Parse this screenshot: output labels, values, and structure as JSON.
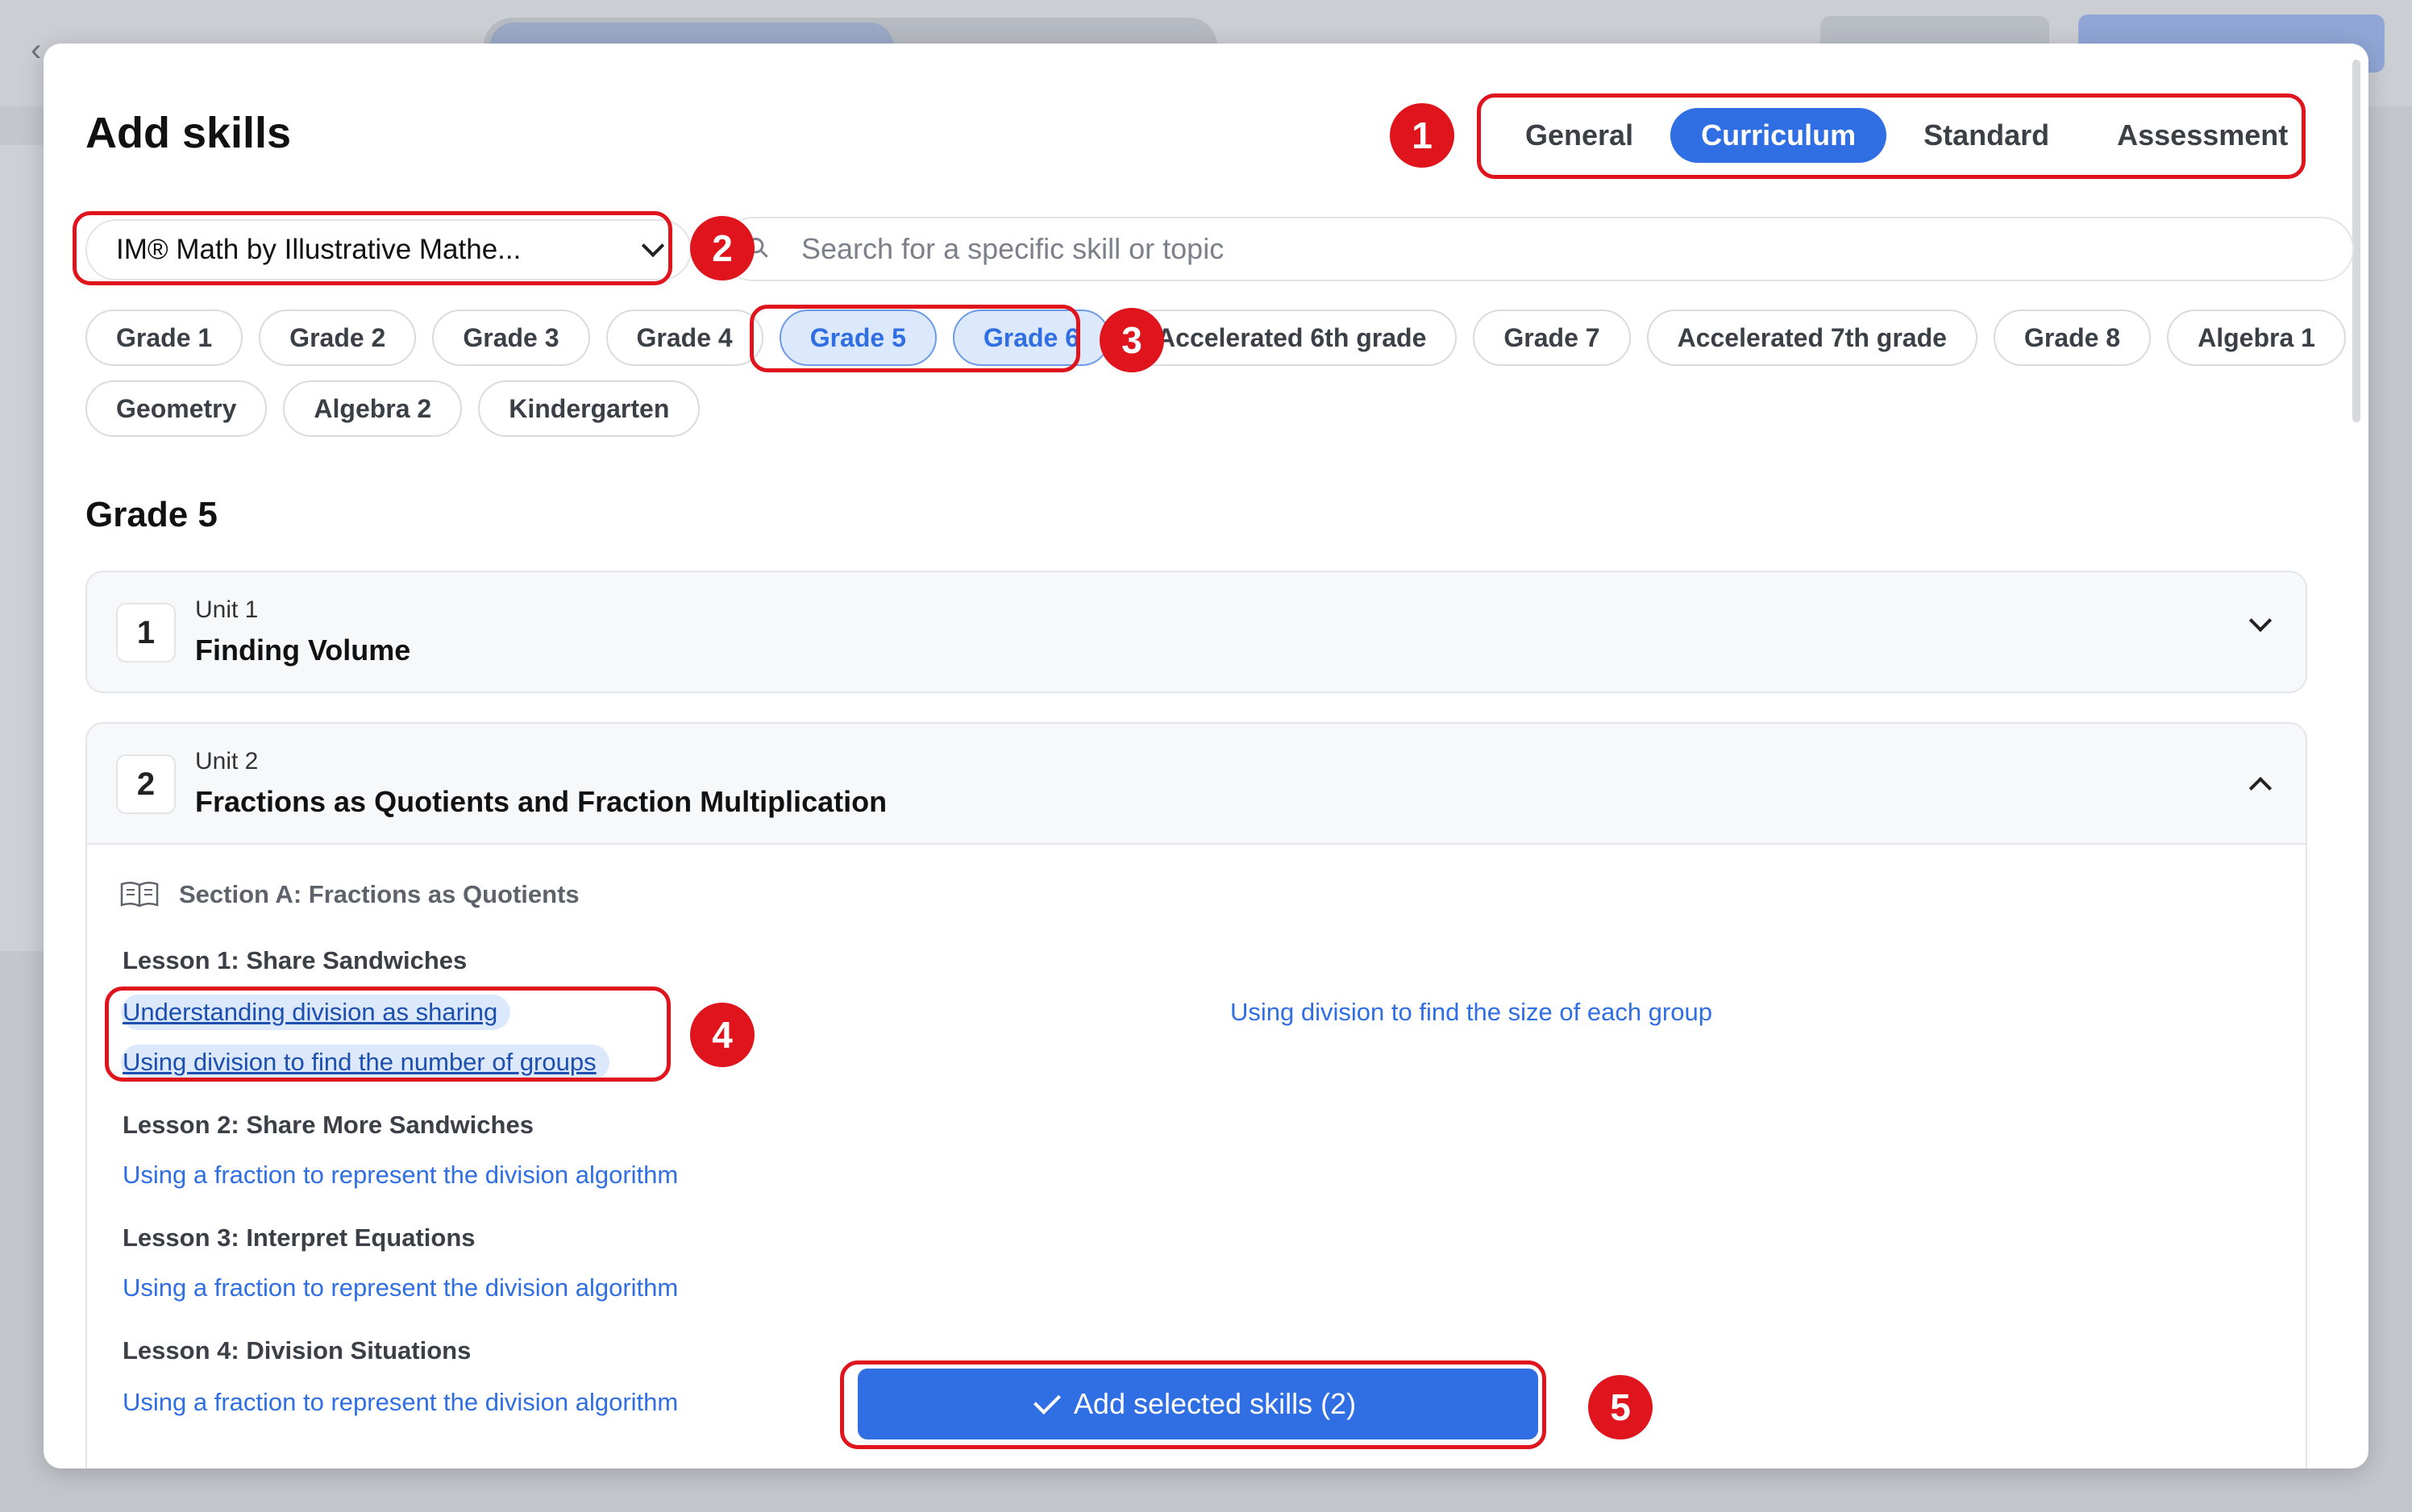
{
  "modal": {
    "title": "Add skills",
    "tabs": [
      {
        "label": "General",
        "active": false
      },
      {
        "label": "Curriculum",
        "active": true
      },
      {
        "label": "Standard",
        "active": false
      },
      {
        "label": "Assessment",
        "active": false
      }
    ],
    "curriculum_select": {
      "value": "IM® Math by Illustrative Mathe..."
    },
    "search": {
      "placeholder": "Search for a specific skill or topic"
    },
    "grades": [
      {
        "label": "Grade 1",
        "selected": false
      },
      {
        "label": "Grade 2",
        "selected": false
      },
      {
        "label": "Grade 3",
        "selected": false
      },
      {
        "label": "Grade 4",
        "selected": false
      },
      {
        "label": "Grade 5",
        "selected": true
      },
      {
        "label": "Grade 6",
        "selected": true
      },
      {
        "label": "Accelerated 6th grade",
        "selected": false
      },
      {
        "label": "Grade 7",
        "selected": false
      },
      {
        "label": "Accelerated 7th grade",
        "selected": false
      },
      {
        "label": "Grade 8",
        "selected": false
      },
      {
        "label": "Algebra 1",
        "selected": false
      },
      {
        "label": "Geometry",
        "selected": false
      },
      {
        "label": "Algebra 2",
        "selected": false
      },
      {
        "label": "Kindergarten",
        "selected": false
      }
    ],
    "grade_heading": "Grade 5",
    "units": [
      {
        "number": "1",
        "subtitle": "Unit 1",
        "title": "Finding Volume",
        "expanded": false
      },
      {
        "number": "2",
        "subtitle": "Unit 2",
        "title": "Fractions as Quotients and Fraction Multiplication",
        "expanded": true
      }
    ],
    "section": {
      "title": "Section A: Fractions as Quotients"
    },
    "lessons": [
      {
        "title": "Lesson 1: Share Sandwiches",
        "skills": [
          {
            "label": "Understanding division as sharing",
            "selected": true
          },
          {
            "label": "Using division to find the size of each group",
            "selected": false
          },
          {
            "label": "Using division to find the number of groups",
            "selected": true
          }
        ]
      },
      {
        "title": "Lesson 2: Share More Sandwiches",
        "skills": [
          {
            "label": "Using a fraction to represent the division algorithm",
            "selected": false
          }
        ]
      },
      {
        "title": "Lesson 3: Interpret Equations",
        "skills": [
          {
            "label": "Using a fraction to represent the division algorithm",
            "selected": false
          }
        ]
      },
      {
        "title": "Lesson 4: Division Situations",
        "skills": [
          {
            "label": "Using a fraction to represent the division algorithm",
            "selected": false
          }
        ]
      }
    ],
    "add_button": {
      "label": "Add selected skills (2)"
    }
  },
  "annotations": [
    "1",
    "2",
    "3",
    "4",
    "5"
  ],
  "colors": {
    "accent": "#2f6ee3",
    "annotation": "#e0141d",
    "selected_bg": "#dce8fb"
  }
}
